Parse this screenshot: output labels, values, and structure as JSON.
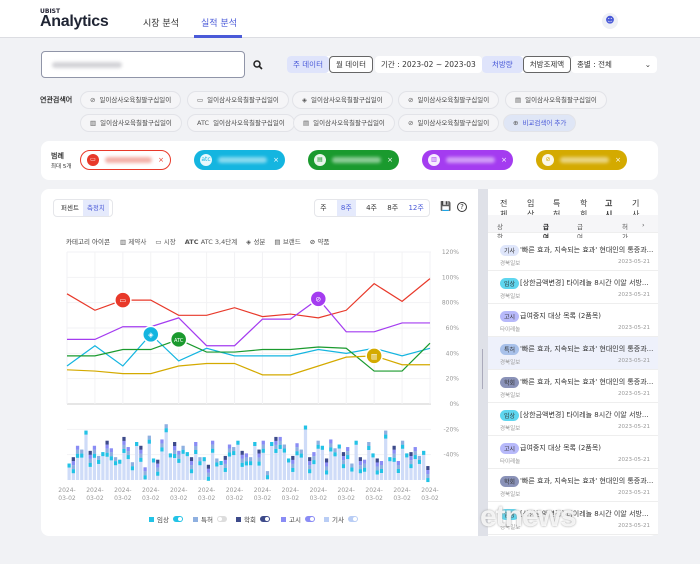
{
  "header": {
    "brand_small": "UBIST",
    "brand": "Analytics",
    "nav": [
      {
        "label": "시장 분석",
        "active": false
      },
      {
        "label": "실적 분석",
        "active": true
      }
    ],
    "user_icon": "user-icon"
  },
  "filters": {
    "search_placeholder": "",
    "week_data": "주 데이터",
    "month_data": "월 데이터",
    "period": "기간 : 2023-02 ~ 2023-03",
    "prescription": "처방량",
    "prescription_amount": "처방조제액",
    "type_select": "종별 : 전체"
  },
  "related": {
    "label": "연관검색어",
    "chips": [
      {
        "icon": "pill-icon",
        "label": "일이삼사오육칠팔구십일이"
      },
      {
        "icon": "market-icon",
        "label": "일이삼사오육칠팔구십일이"
      },
      {
        "icon": "ingredient-icon",
        "label": "일이삼사오육칠팔구십일이"
      },
      {
        "icon": "pill-icon",
        "label": "일이삼사오육칠팔구십일이"
      },
      {
        "icon": "brand-icon",
        "label": "일이삼사오육칠팔구십일이"
      },
      {
        "icon": "company-icon",
        "label": "일이삼사오육칠팔구십일이"
      },
      {
        "icon": "atc-icon",
        "label": "일이삼사오육칠팔구십일이"
      },
      {
        "icon": "brand-icon",
        "label": "일이삼사오육칠팔구십일이"
      },
      {
        "icon": "pill-icon",
        "label": "일이삼사오육칠팔구십일이"
      }
    ],
    "add_label": "비교검색어 추가"
  },
  "legend": {
    "label": "범례",
    "sublabel": "최대 5개",
    "items": [
      {
        "color": "#e8392a",
        "icon": "market-icon"
      },
      {
        "color": "#14b5e0",
        "icon": "atc-icon"
      },
      {
        "color": "#1a9a2e",
        "icon": "brand-icon"
      },
      {
        "color": "#a43cf0",
        "icon": "company-icon"
      },
      {
        "color": "#d4aa00",
        "icon": "pill-icon"
      }
    ]
  },
  "chart_controls": {
    "percent": "퍼센트",
    "measured": "측정치",
    "periods": [
      "주",
      "8주",
      "4주",
      "8주",
      "12주"
    ],
    "active_period": "8주"
  },
  "category_icons": {
    "label": "카테고리 아이콘",
    "items": [
      "제약사",
      "시장",
      "ATC 3,4단계",
      "성분",
      "브랜드",
      "약품"
    ]
  },
  "chart_data": {
    "type": "line",
    "x": [
      "2024-03-02",
      "2024-03-02",
      "2024-03-02",
      "2024-03-02",
      "2024-03-02",
      "2024-03-02",
      "2024-03-02",
      "2024-03-02",
      "2024-03-02",
      "2024-03-02",
      "2024-03-02",
      "2024-03-02",
      "2024-03-02",
      "2024-03-02"
    ],
    "y_ticks": [
      "120%",
      "100%",
      "800%",
      "60%",
      "40%",
      "20%",
      "0%",
      "-20%",
      "-40%"
    ],
    "ylim": [
      -60,
      120
    ],
    "series": [
      {
        "color": "#e8392a",
        "values": [
          87,
          74,
          82,
          82,
          70,
          70,
          76,
          69,
          71,
          68,
          74,
          95,
          81,
          99
        ],
        "marker_index": 2,
        "marker": "market-icon"
      },
      {
        "color": "#a43cf0",
        "values": [
          51,
          51,
          61,
          61,
          68,
          46,
          46,
          67,
          67,
          83,
          57,
          57,
          64,
          64
        ],
        "marker_index": 9,
        "marker": "pill-icon"
      },
      {
        "color": "#14b5e0",
        "values": [
          30,
          46,
          30,
          55,
          34,
          44,
          38,
          38,
          38,
          43,
          40,
          44,
          38,
          44
        ],
        "marker_index": 3,
        "marker": "ingredient-icon"
      },
      {
        "color": "#1a9a2e",
        "values": [
          38,
          38,
          43,
          43,
          51,
          41,
          41,
          43,
          43,
          45,
          44,
          26,
          26,
          48
        ],
        "marker_index": 4,
        "marker": "atc-icon"
      },
      {
        "color": "#d4aa00",
        "values": [
          27,
          26,
          24,
          24,
          30,
          32,
          32,
          23,
          23,
          30,
          37,
          38,
          31,
          31
        ],
        "marker_index": 11,
        "marker": "company-icon"
      }
    ],
    "bars": [
      -47,
      -42,
      -33,
      -36,
      -21,
      -37,
      -33,
      -41,
      -38,
      -29,
      -35,
      -42,
      -44,
      -26,
      -34,
      -46,
      -30,
      -33,
      -50,
      -25,
      -43,
      -44,
      -28,
      -16,
      -39,
      -30,
      -37,
      -33,
      -38,
      -42,
      -30,
      -42,
      -42,
      -48,
      -29,
      -43,
      -45,
      -41,
      -32,
      -34,
      -29,
      -37,
      -39,
      -42,
      -30,
      -36,
      -29,
      -53,
      -30,
      -26,
      -26,
      -32,
      -43,
      -41,
      -31,
      -36,
      -17,
      -42,
      -38,
      -29,
      -33,
      -43,
      -28,
      -35,
      -32,
      -38,
      -34,
      -47,
      -29,
      -42,
      -44,
      -30,
      -39,
      -43,
      -45,
      -21,
      -42,
      -33,
      -45,
      -29,
      -39,
      -38,
      -34,
      -41,
      -37,
      -49
    ],
    "bar_legend": [
      {
        "label": "임상",
        "color": "#22c3e6",
        "on": true
      },
      {
        "label": "특허",
        "color": "#8fb0e0",
        "on": false
      },
      {
        "label": "학회",
        "color": "#3d4a8a",
        "on": true
      },
      {
        "label": "고시",
        "color": "#8a8cf5",
        "on": true
      },
      {
        "label": "기사",
        "color": "#b9cdf5",
        "on": true
      }
    ]
  },
  "news": {
    "tabs": [
      "전체",
      "임상",
      "특허",
      "학회",
      "고시",
      "기사"
    ],
    "active_tab": "고시",
    "subtabs": [
      "상한금액변경",
      "급여중지",
      "급여중지해제",
      "허가사"
    ],
    "active_subtab": "급여중지",
    "items": [
      {
        "badge": "기사",
        "badge_color": "#dfe6fb",
        "title": "'빠른 효과, 지속되는 효과' 현대인의 통증과...",
        "source": "경북일보",
        "date": "2023-05-21"
      },
      {
        "badge": "임상",
        "badge_color": "#5fd6ef",
        "title": "[상한금액변경] 타이레놀 8시간 이알 서방...",
        "source": "경북일보",
        "date": "2023-05-21"
      },
      {
        "badge": "고시",
        "badge_color": "#b7b9fa",
        "title": "급여중지 대상 목록 (2품목)",
        "source": "타이레놀",
        "date": "2023-05-21"
      },
      {
        "badge": "특허",
        "badge_color": "#a8c1ea",
        "title": "'빠른 효과, 지속되는 효과' 현대인의 통증과...",
        "source": "경북일보",
        "date": "2023-05-21"
      },
      {
        "badge": "학회",
        "badge_color": "#8a92b8",
        "title": "'빠른 효과, 지속되는 효과' 현대인의 통증과...",
        "source": "경북일보",
        "date": "2023-05-21"
      },
      {
        "badge": "임상",
        "badge_color": "#5fd6ef",
        "title": "[상한금액변경] 타이레놀 8시간 이알 서방...",
        "source": "경북일보",
        "date": "2023-05-21"
      },
      {
        "badge": "고시",
        "badge_color": "#b7b9fa",
        "title": "급여중지 대상 목록 (2품목)",
        "source": "타이레놀",
        "date": "2023-05-21"
      },
      {
        "badge": "학회",
        "badge_color": "#8a92b8",
        "title": "'빠른 효과, 지속되는 효과' 현대인의 통증과...",
        "source": "경북일보",
        "date": "2023-05-21"
      },
      {
        "badge": "임상",
        "badge_color": "#5fd6ef",
        "title": "[상한금액변경] 타이레놀 8시간 이알 서방...",
        "source": "경북일보",
        "date": "2023-05-21"
      }
    ]
  },
  "watermark": "etnews"
}
